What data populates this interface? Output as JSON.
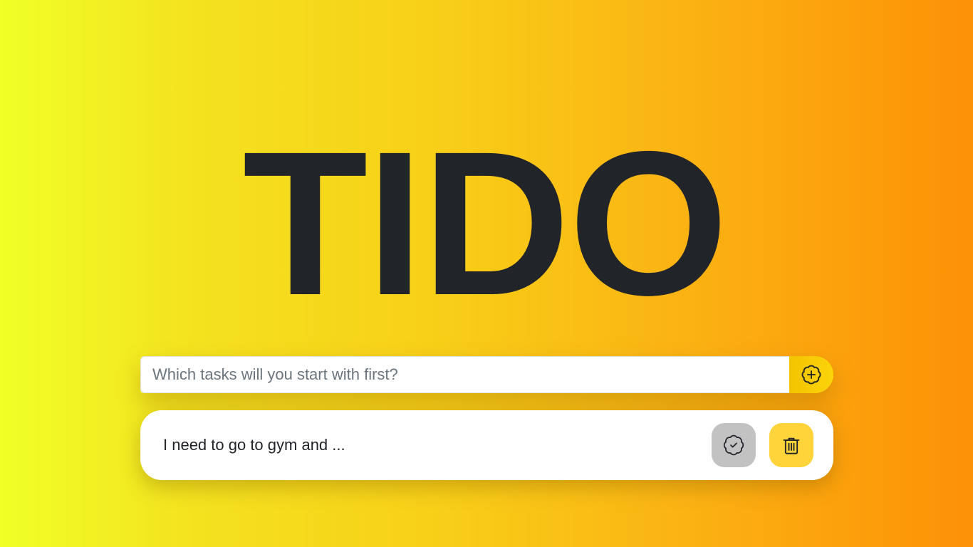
{
  "app": {
    "title": "TIDO"
  },
  "new_task": {
    "value": "",
    "placeholder": "Which tasks will you start with first?",
    "add_icon": "badge-plus-icon"
  },
  "tasks": [
    {
      "text": "I need to go to gym and ...",
      "complete_icon": "badge-check-icon",
      "delete_icon": "trash-icon"
    }
  ],
  "colors": {
    "gradient_start": "#f0ff26",
    "gradient_end": "#fd9106",
    "title": "#212529",
    "add_button": "#fcd40a",
    "complete_button": "#c2c2c2",
    "delete_button": "#ffd43b"
  }
}
